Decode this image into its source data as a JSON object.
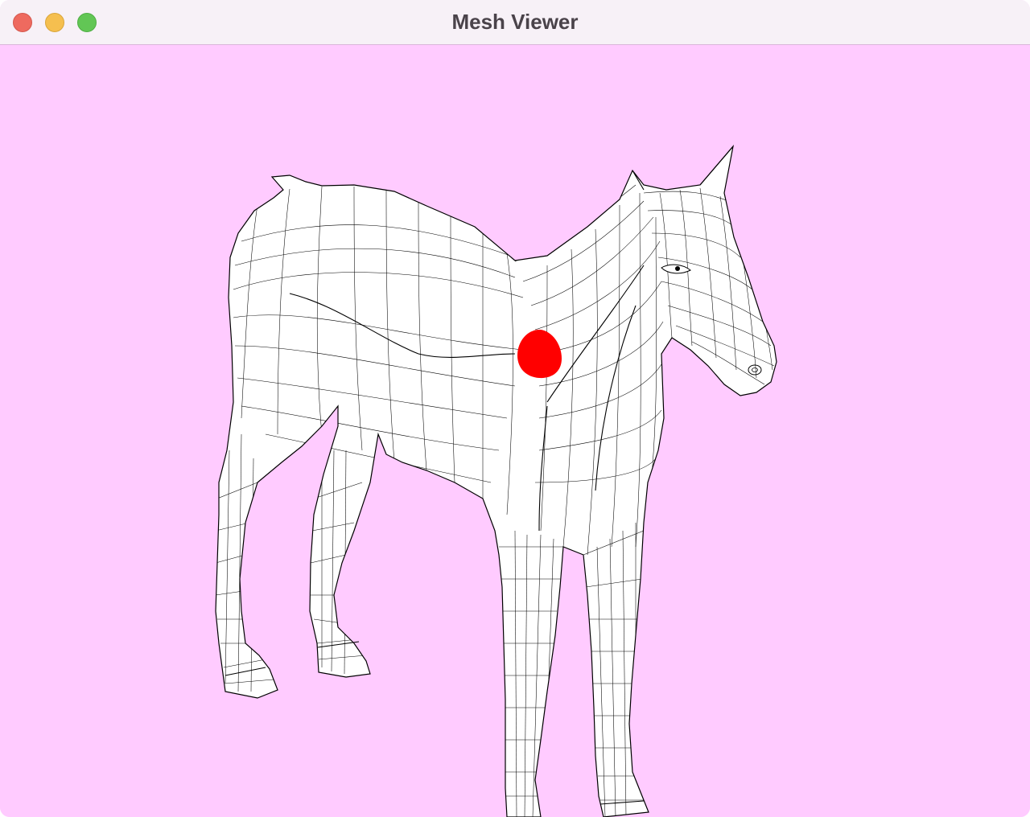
{
  "window": {
    "title": "Mesh Viewer",
    "controls": [
      "close",
      "minimize",
      "maximize"
    ]
  },
  "viewport": {
    "background_color": "#ffcbff",
    "model": "horse-wireframe-mesh",
    "mesh_fill_color": "#ffffff",
    "wire_color": "#000000",
    "marker_color": "#ff0000"
  }
}
